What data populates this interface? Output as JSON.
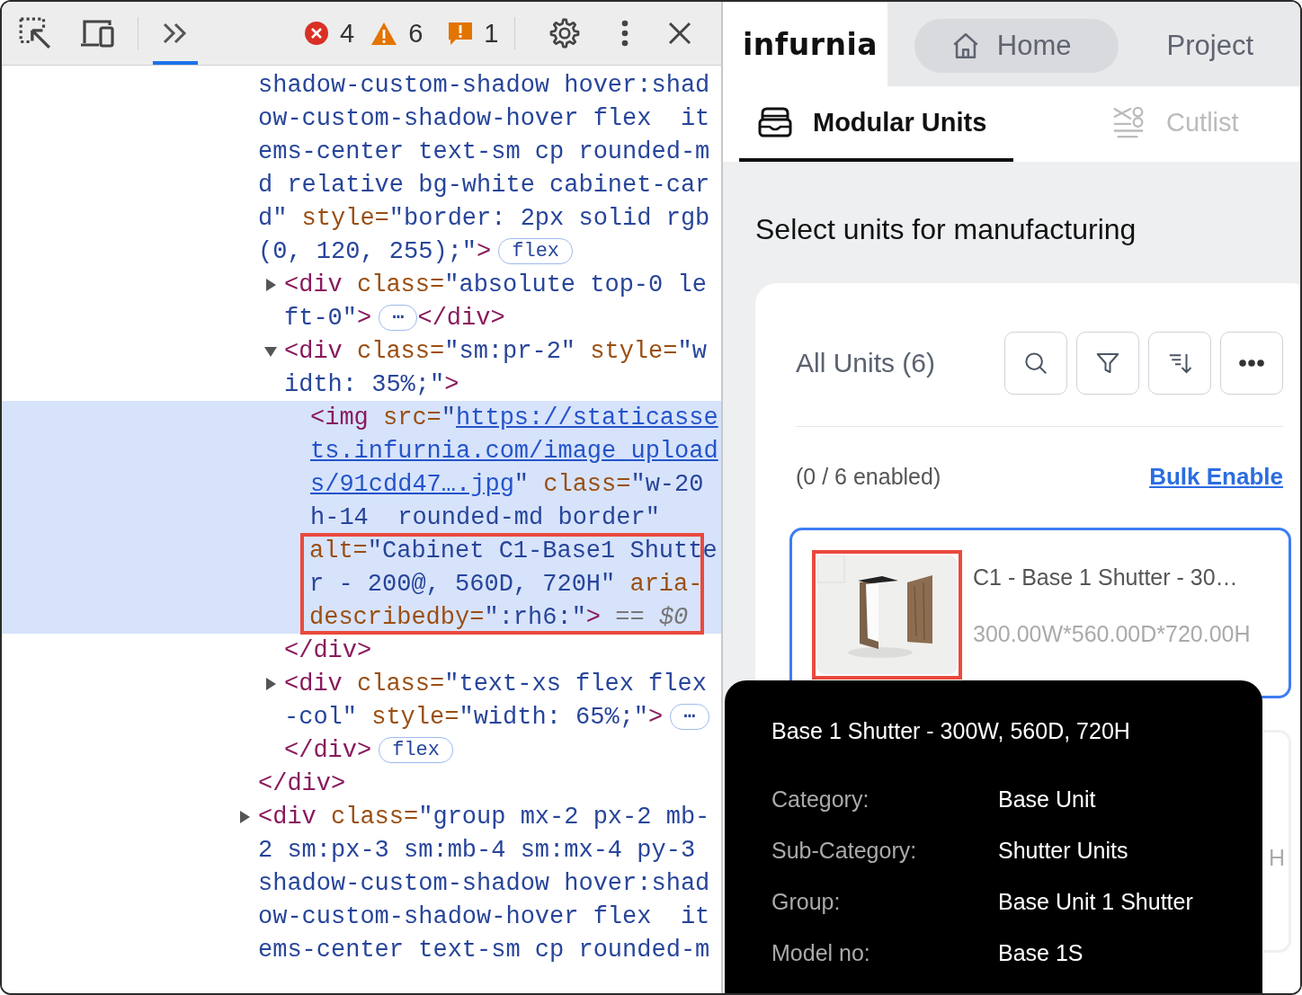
{
  "devtools": {
    "toolbar": {
      "panel_tab": {
        "selected": true
      },
      "errors": "4",
      "warnings": "6",
      "issues": "1"
    },
    "dom_tree": [
      {
        "selected": false,
        "lines": [
          [
            {
              "kind": "value",
              "s": "shadow-custom-shadow hover:shad"
            }
          ],
          [
            {
              "kind": "value",
              "s": "ow-custom-shadow-hover flex  it"
            }
          ],
          [
            {
              "kind": "value",
              "s": "ems-center text-sm cp rounded-m"
            }
          ],
          [
            {
              "kind": "value",
              "s": "d relative bg-white cabinet-car"
            }
          ],
          [
            {
              "kind": "value",
              "s": "d\""
            },
            {
              "kind": "attr",
              "s": " style="
            },
            {
              "kind": "value",
              "s": "\"border: 2px solid rgb"
            }
          ],
          [
            {
              "kind": "value",
              "s": "(0, 120, 255);\""
            },
            {
              "kind": "tag",
              "s": ">"
            },
            {
              "kind": "badge",
              "s": "flex"
            }
          ]
        ],
        "children": [
          {
            "expanded": false,
            "selected": false,
            "lines": [
              [
                {
                  "kind": "tag",
                  "s": "<div"
                },
                {
                  "kind": "attr",
                  "s": " class="
                },
                {
                  "kind": "value",
                  "s": "\"absolute top-0 le"
                }
              ],
              [
                {
                  "kind": "value",
                  "s": "ft-0\""
                },
                {
                  "kind": "tag",
                  "s": ">"
                },
                {
                  "kind": "badge",
                  "s": "⋯"
                },
                {
                  "kind": "tag",
                  "s": "</div>"
                }
              ]
            ]
          },
          {
            "expanded": true,
            "selected": false,
            "lines": [
              [
                {
                  "kind": "tag",
                  "s": "<div"
                },
                {
                  "kind": "attr",
                  "s": " class="
                },
                {
                  "kind": "value",
                  "s": "\"sm:pr-2\""
                },
                {
                  "kind": "attr",
                  "s": " style="
                },
                {
                  "kind": "value",
                  "s": "\"w"
                }
              ],
              [
                {
                  "kind": "value",
                  "s": "idth: 35%;\""
                },
                {
                  "kind": "tag",
                  "s": ">"
                }
              ]
            ],
            "children": [
              {
                "selected": true,
                "lines": [
                  [
                    {
                      "kind": "tag",
                      "s": "<img"
                    },
                    {
                      "kind": "attr",
                      "s": " src="
                    },
                    {
                      "kind": "value",
                      "s": "\""
                    },
                    {
                      "kind": "link",
                      "s": "https://staticasse"
                    }
                  ],
                  [
                    {
                      "kind": "link",
                      "s": "ts.infurnia.com/image_upload"
                    }
                  ],
                  [
                    {
                      "kind": "link",
                      "s": "s/91cdd47….jpg"
                    },
                    {
                      "kind": "value",
                      "s": "\""
                    },
                    {
                      "kind": "attr",
                      "s": " class="
                    },
                    {
                      "kind": "value",
                      "s": "\"w-20"
                    }
                  ],
                  [
                    {
                      "kind": "value",
                      "s": "h-14  rounded-md border\""
                    }
                  ]
                ],
                "annotation": {
                  "lines": [
                    [
                      {
                        "kind": "attr",
                        "s": "alt="
                      },
                      {
                        "kind": "value",
                        "s": "\"Cabinet C1-Base1 Shutte"
                      }
                    ],
                    [
                      {
                        "kind": "value",
                        "s": "r - 200@, 560D, 720H\""
                      },
                      {
                        "kind": "attr",
                        "s": " aria-"
                      }
                    ],
                    [
                      {
                        "kind": "attr",
                        "s": "describedby="
                      },
                      {
                        "kind": "value",
                        "s": "\":rh6:\""
                      },
                      {
                        "kind": "tag",
                        "s": ">"
                      },
                      {
                        "kind": "dim",
                        "s": " == "
                      },
                      {
                        "kind": "var",
                        "s": "$0"
                      }
                    ]
                  ]
                }
              }
            ],
            "closing": [
              {
                "kind": "tag",
                "s": "</div>"
              }
            ]
          },
          {
            "expanded": false,
            "selected": false,
            "lines": [
              [
                {
                  "kind": "tag",
                  "s": "<div"
                },
                {
                  "kind": "attr",
                  "s": " class="
                },
                {
                  "kind": "value",
                  "s": "\"text-xs flex flex"
                }
              ],
              [
                {
                  "kind": "value",
                  "s": "-col\""
                },
                {
                  "kind": "attr",
                  "s": " style="
                },
                {
                  "kind": "value",
                  "s": "\"width: 65%;\""
                },
                {
                  "kind": "tag",
                  "s": ">"
                },
                {
                  "kind": "badge",
                  "s": "⋯"
                }
              ],
              [
                {
                  "kind": "tag",
                  "s": "</div>"
                },
                {
                  "kind": "badge",
                  "s": "flex"
                }
              ]
            ]
          }
        ],
        "closing": [
          {
            "kind": "tag",
            "s": "</div>"
          }
        ]
      },
      {
        "expanded": false,
        "selected": false,
        "lines": [
          [
            {
              "kind": "tag",
              "s": "<div"
            },
            {
              "kind": "attr",
              "s": " class="
            },
            {
              "kind": "value",
              "s": "\"group mx-2 px-2 mb-"
            }
          ],
          [
            {
              "kind": "value",
              "s": "2 sm:px-3 sm:mb-4 sm:mx-4 py-3"
            }
          ],
          [
            {
              "kind": "value",
              "s": "shadow-custom-shadow hover:shad"
            }
          ],
          [
            {
              "kind": "value",
              "s": "ow-custom-shadow-hover flex  it"
            }
          ],
          [
            {
              "kind": "value",
              "s": "ems-center text-sm cp rounded-m"
            }
          ]
        ]
      }
    ]
  },
  "app": {
    "logo": "infurnia",
    "top_tabs": [
      {
        "label": "Home",
        "kind": "home",
        "selected": true
      },
      {
        "label": "Project",
        "kind": "project",
        "selected": false
      }
    ],
    "sub_tabs": [
      {
        "label": "Modular Units",
        "kind": "units",
        "selected": true
      },
      {
        "label": "Cutlist",
        "kind": "cutlist",
        "selected": false
      }
    ],
    "heading": "Select units for manufacturing",
    "units_panel": {
      "title": "All Units (6)",
      "tools": [
        {
          "kind": "search"
        },
        {
          "kind": "filter"
        },
        {
          "kind": "sort"
        },
        {
          "kind": "more"
        }
      ],
      "enabled_count": "(0 / 6 enabled)",
      "bulk_action": "Bulk Enable",
      "units": [
        {
          "title": "C1 - Base 1 Shutter - 30…",
          "dims": "300.00W*560.00D*720.00H",
          "selected": true,
          "annotated": true
        },
        {
          "dims": "H",
          "selected": false,
          "annotated": false
        }
      ]
    },
    "tooltip": {
      "title": "Base 1 Shutter - 300W, 560D, 720H",
      "rows": [
        {
          "label": "Category:",
          "value": "Base Unit"
        },
        {
          "label": "Sub-Category:",
          "value": "Shutter Units"
        },
        {
          "label": "Group:",
          "value": "Base Unit 1 Shutter"
        },
        {
          "label": "Model no:",
          "value": "Base 1S"
        }
      ]
    }
  }
}
